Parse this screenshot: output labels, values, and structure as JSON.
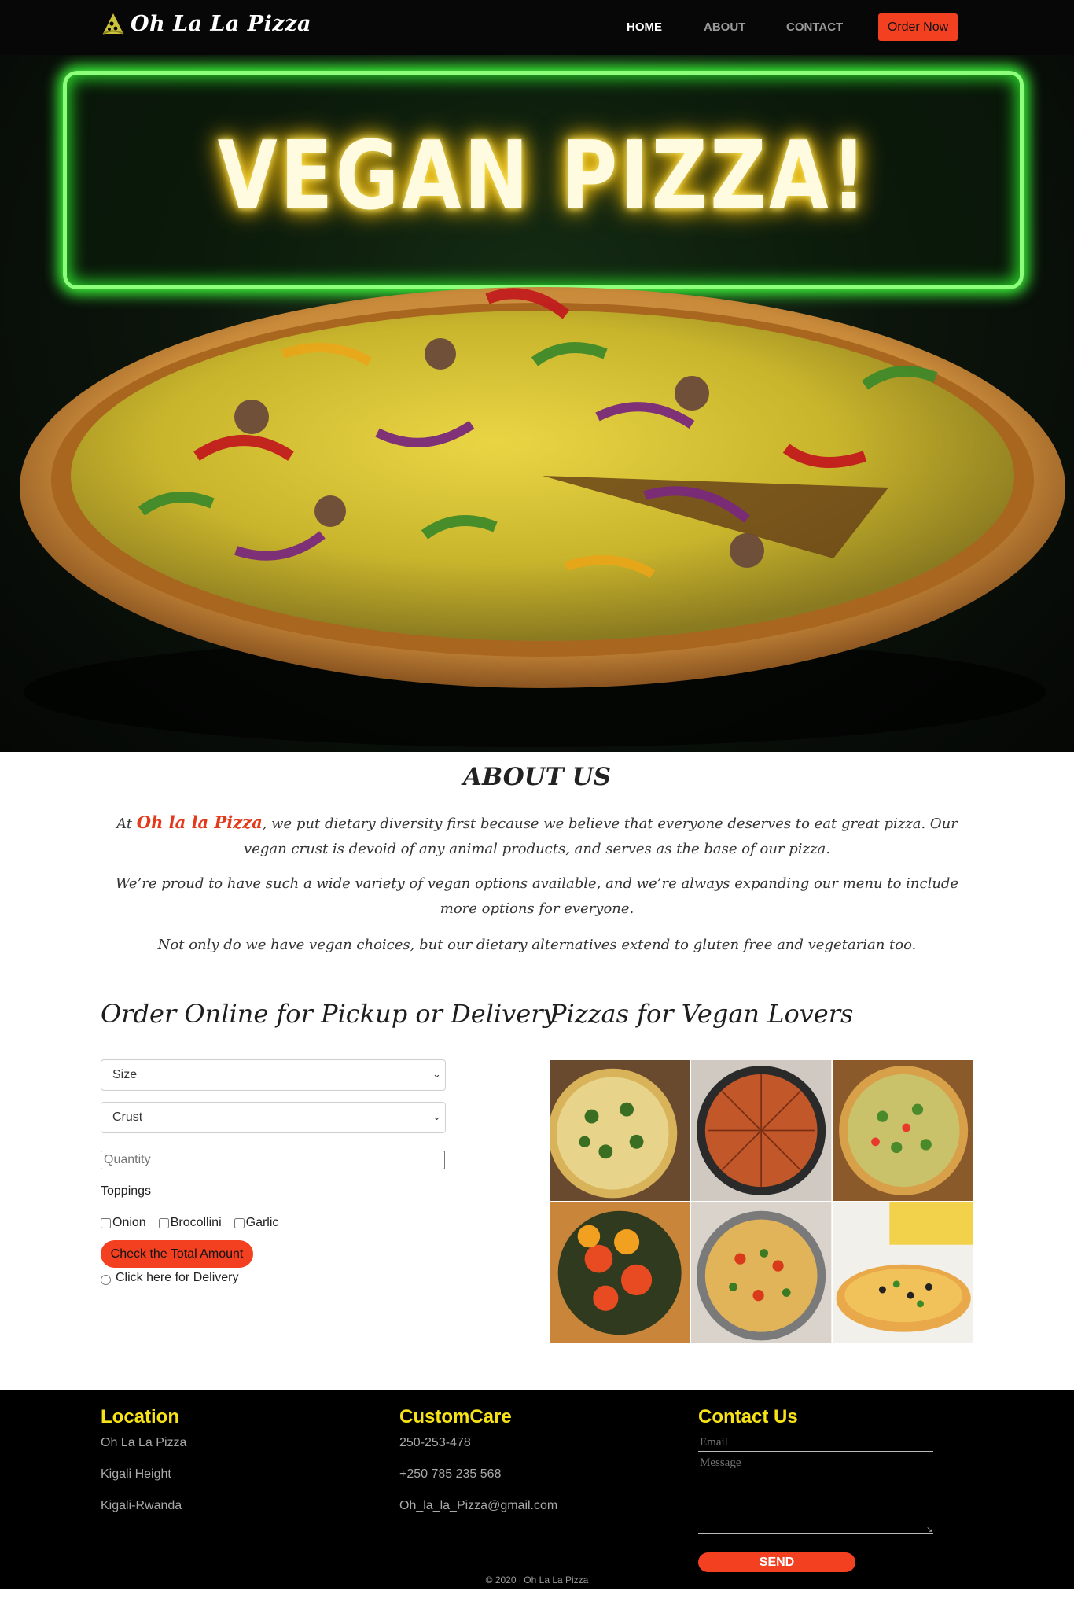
{
  "nav": {
    "brand": "Oh La La Pizza",
    "links": [
      {
        "label": "HOME",
        "active": true
      },
      {
        "label": "ABOUT",
        "active": false
      },
      {
        "label": "CONTACT",
        "active": false
      }
    ],
    "order_button": "Order Now"
  },
  "hero": {
    "neon_title": "VEGAN PIZZA!",
    "neon_color": "#8dff7a",
    "text_glow": "#ffd21a"
  },
  "about": {
    "title": "ABOUT US",
    "p1_prefix": "At ",
    "p1_brand": "Oh la la Pizza",
    "p1_rest": ", we put dietary diversity first because we believe that everyone deserves to eat great pizza. Our vegan crust is devoid of any animal products, and serves as the base of our pizza.",
    "p2": "We’re proud to have such a wide variety of vegan options available, and we’re always expanding our menu to include more options for everyone.",
    "p3": "Not only do we have vegan choices, but our dietary alternatives extend to gluten free and vegetarian too."
  },
  "order": {
    "title": "Order Online for Pickup or Delivery",
    "size_select": "Size",
    "crust_select": "Crust",
    "quantity_placeholder": "Quantity",
    "toppings_label": "Toppings",
    "toppings": [
      "Onion",
      "Brocollini",
      "Garlic"
    ],
    "total_button": "Check the Total Amount",
    "delivery_label": "Click here for Delivery"
  },
  "gallery": {
    "title": "Pizzas for Vegan Lovers",
    "images": [
      "broccoli-pizza",
      "pepperoni-style-pizza",
      "green-veggie-pizza",
      "tomato-pizza",
      "pepper-pizza",
      "olive-pizza"
    ]
  },
  "footer": {
    "location": {
      "title": "Location",
      "lines": [
        "Oh La La Pizza",
        "Kigali Height",
        "Kigali-Rwanda"
      ]
    },
    "customcare": {
      "title": "CustomCare",
      "lines": [
        "250-253-478",
        "+250 785 235 568",
        "Oh_la_la_Pizza@gmail.com"
      ]
    },
    "contact": {
      "title": "Contact Us",
      "email_placeholder": "Email",
      "message_placeholder": "Message",
      "send_button": "SEND"
    },
    "copyright": "© 2020 | Oh La La Pizza"
  },
  "colors": {
    "accent": "#f24020",
    "footer_heading": "#f7e217",
    "nav_bg": "#070707"
  }
}
